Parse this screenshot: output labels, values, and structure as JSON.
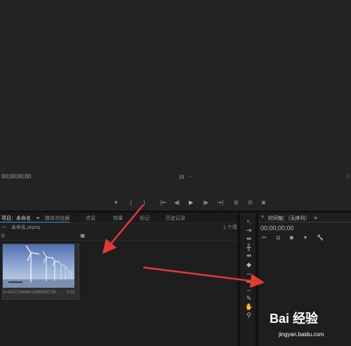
{
  "monitor": {
    "timecode_left": "00;00;00;00",
    "controls": {
      "marker": "♥",
      "mark_in": "{",
      "mark_out": "}",
      "go_in": "{⇤",
      "step_back": "◀|",
      "play": "▶",
      "step_fwd": "|▶",
      "go_out": "⇥}",
      "insert": "⊞",
      "overwrite": "⊟",
      "camera": "◙"
    }
  },
  "project_panel": {
    "tabs": [
      {
        "label": "项目：未命名",
        "menu": "≡"
      },
      {
        "label": "媒体浏览器"
      },
      {
        "label": "信息"
      },
      {
        "label": "效果"
      },
      {
        "label": "标记"
      },
      {
        "label": "历史记录"
      }
    ],
    "project_file": "未命名.prproj",
    "item_count": "1 个项",
    "clip": {
      "name": "u=1837164644,3465680728...",
      "duration": "5:00"
    }
  },
  "timeline_panel": {
    "title": "时间轴：（无序列）",
    "menu": "≡",
    "timecode": "00;00;00;00"
  },
  "watermark": {
    "logo": "Bai 经验",
    "url": "jingyan.baidu.com"
  },
  "colors": {
    "background": "#1e1e1e",
    "accent_blue": "#4a7fbf",
    "arrow_red": "#e53935"
  }
}
